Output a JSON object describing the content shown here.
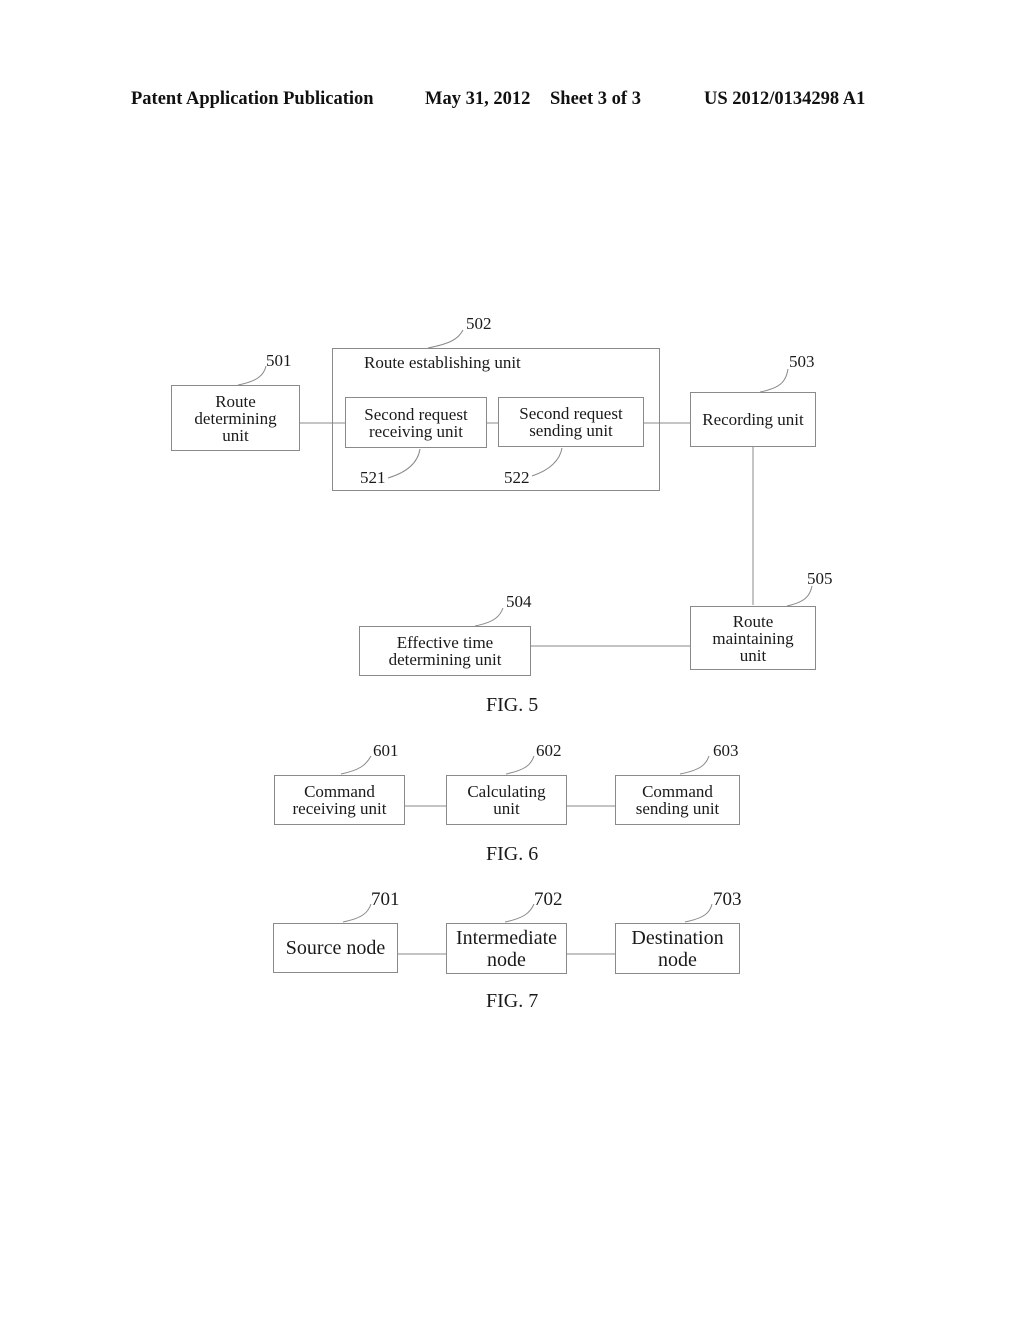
{
  "header": {
    "publication": "Patent Application Publication",
    "date": "May 31, 2012",
    "sheet": "Sheet 3 of 3",
    "number": "US 2012/0134298 A1"
  },
  "fig5": {
    "caption": "FIG. 5",
    "route_determining": {
      "ref": "501",
      "label": "Route\ndetermining\nunit"
    },
    "route_establishing": {
      "ref": "502",
      "label": "Route establishing unit",
      "second_request_receiving": {
        "ref": "521",
        "label": "Second request\nreceiving unit"
      },
      "second_request_sending": {
        "ref": "522",
        "label": "Second request\nsending unit"
      }
    },
    "recording": {
      "ref": "503",
      "label": "Recording unit"
    },
    "effective_time": {
      "ref": "504",
      "label": "Effective time\ndetermining unit"
    },
    "route_maintaining": {
      "ref": "505",
      "label": "Route\nmaintaining\nunit"
    }
  },
  "fig6": {
    "caption": "FIG. 6",
    "command_receiving": {
      "ref": "601",
      "label": "Command\nreceiving unit"
    },
    "calculating": {
      "ref": "602",
      "label": "Calculating\nunit"
    },
    "command_sending": {
      "ref": "603",
      "label": "Command\nsending unit"
    }
  },
  "fig7": {
    "caption": "FIG. 7",
    "source": {
      "ref": "701",
      "label": "Source node"
    },
    "intermediate": {
      "ref": "702",
      "label": "Intermediate\nnode"
    },
    "destination": {
      "ref": "703",
      "label": "Destination\nnode"
    }
  }
}
